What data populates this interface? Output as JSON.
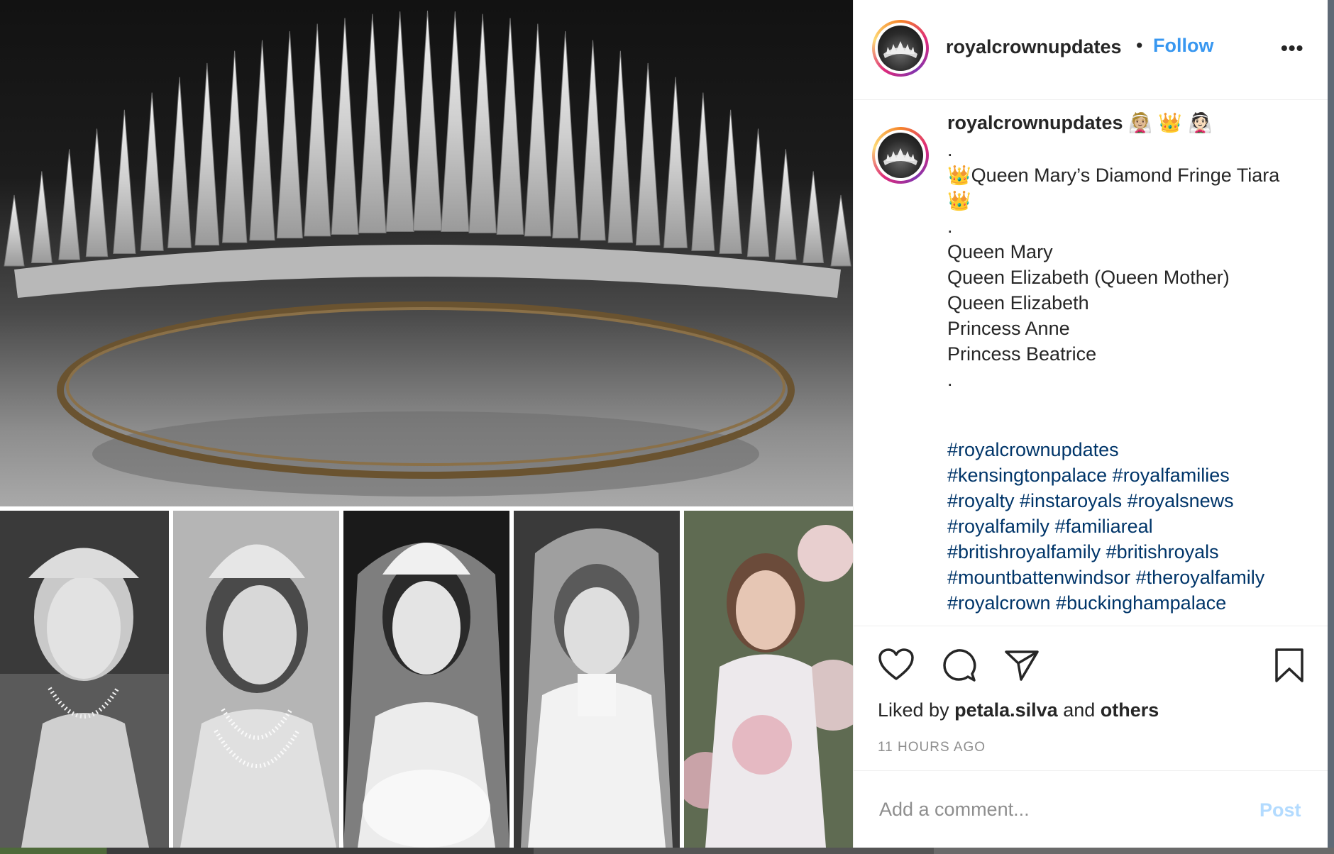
{
  "post": {
    "username": "royalcrownupdates",
    "follow_label": "Follow",
    "dot_separator": "•",
    "more_label": "•••"
  },
  "caption": {
    "username": "royalcrownupdates",
    "emojis": "👰🏼 👑 👰🏻",
    "lines": [
      ".",
      "👑Queen Mary’s Diamond Fringe Tiara",
      "👑",
      ".",
      "Queen Mary",
      "Queen Elizabeth (Queen Mother)",
      "Queen Elizabeth",
      "Princess Anne",
      "Princess Beatrice",
      ".",
      ""
    ],
    "hashtags": [
      "#royalcrownupdates",
      "#kensingtonpalace #royalfamilies",
      "#royalty #instaroyals #royalsnews",
      "#royalfamily #familiareal",
      "#britishroyalfamily #britishroyals",
      "#mountbattenwindsor #theroyalfamily",
      "#royalcrown #buckinghampalace"
    ]
  },
  "engagement": {
    "liked_prefix": "Liked by",
    "liked_user": "petala.silva",
    "liked_and": "and",
    "liked_others": "others",
    "timestamp": "11 HOURS AGO"
  },
  "comment": {
    "placeholder": "Add a comment...",
    "post_label": "Post"
  },
  "icons": {
    "like": "heart-icon",
    "comment": "comment-bubble-icon",
    "share": "paper-plane-icon",
    "save": "bookmark-icon",
    "more": "ellipsis-icon"
  },
  "colors": {
    "link": "#3897f0",
    "hashtag": "#003569",
    "text": "#262626",
    "muted": "#8e8e8e",
    "post_disabled": "#b3dbff"
  }
}
